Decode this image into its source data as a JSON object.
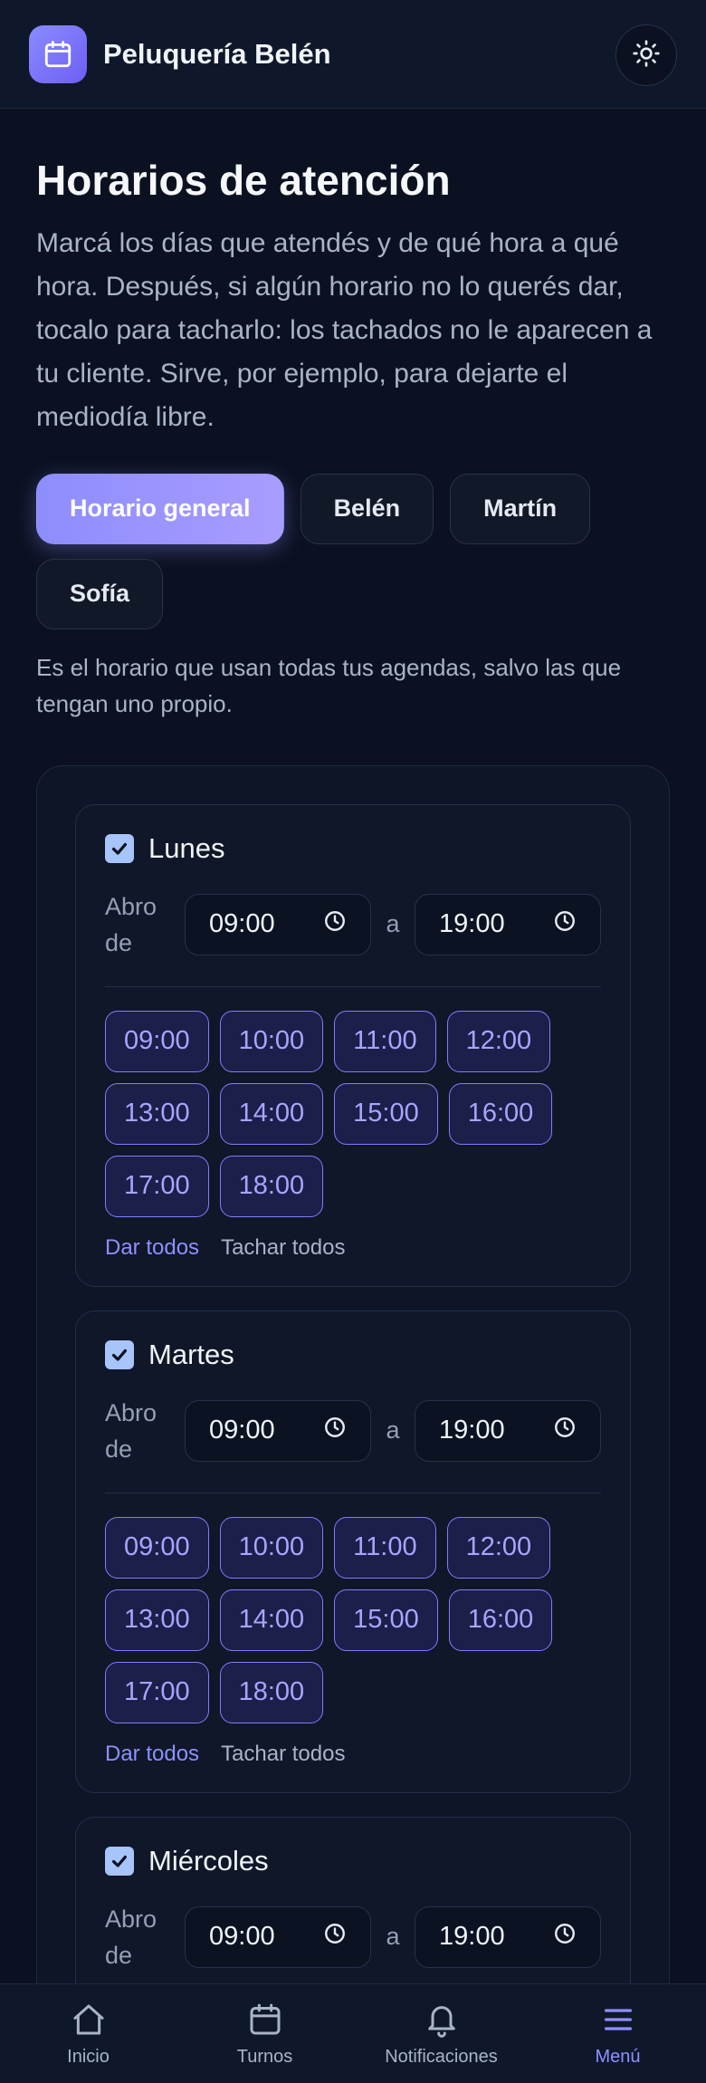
{
  "header": {
    "app_title": "Peluquería Belén",
    "logo_icon": "calendar-icon",
    "theme_icon": "sun-icon"
  },
  "page": {
    "title": "Horarios de atención",
    "description": "Marcá los días que atendés y de qué hora a qué hora. Después, si algún horario no lo querés dar, tocalo para tacharlo: los tachados no le aparecen a tu cliente. Sirve, por ejemplo, para dejarte el mediodía libre."
  },
  "tabs": [
    {
      "label": "Horario general",
      "active": true
    },
    {
      "label": "Belén",
      "active": false
    },
    {
      "label": "Martín",
      "active": false
    },
    {
      "label": "Sofía",
      "active": false
    }
  ],
  "tab_hint": "Es el horario que usan todas tus agendas, salvo las que tengan uno propio.",
  "days": [
    {
      "name": "Lunes",
      "checked": true,
      "open_label": "Abro de",
      "to_label": "a",
      "from": "09:00",
      "to": "19:00",
      "slots": [
        "09:00",
        "10:00",
        "11:00",
        "12:00",
        "13:00",
        "14:00",
        "15:00",
        "16:00",
        "17:00",
        "18:00"
      ],
      "give_all": "Dar todos",
      "strike_all": "Tachar todos"
    },
    {
      "name": "Martes",
      "checked": true,
      "open_label": "Abro de",
      "to_label": "a",
      "from": "09:00",
      "to": "19:00",
      "slots": [
        "09:00",
        "10:00",
        "11:00",
        "12:00",
        "13:00",
        "14:00",
        "15:00",
        "16:00",
        "17:00",
        "18:00"
      ],
      "give_all": "Dar todos",
      "strike_all": "Tachar todos"
    },
    {
      "name": "Miércoles",
      "checked": true,
      "open_label": "Abro de",
      "to_label": "a",
      "from": "09:00",
      "to": "19:00",
      "slots": [],
      "give_all": "",
      "strike_all": ""
    }
  ],
  "nav": [
    {
      "label": "Inicio",
      "icon": "home-icon",
      "active": false
    },
    {
      "label": "Turnos",
      "icon": "calendar-icon",
      "active": false
    },
    {
      "label": "Notificaciones",
      "icon": "bell-icon",
      "active": false
    },
    {
      "label": "Menú",
      "icon": "menu-icon",
      "active": true
    }
  ],
  "colors": {
    "accent": "#8f90ff",
    "background": "#0b1120",
    "checkbox": "#a7c4fb"
  }
}
